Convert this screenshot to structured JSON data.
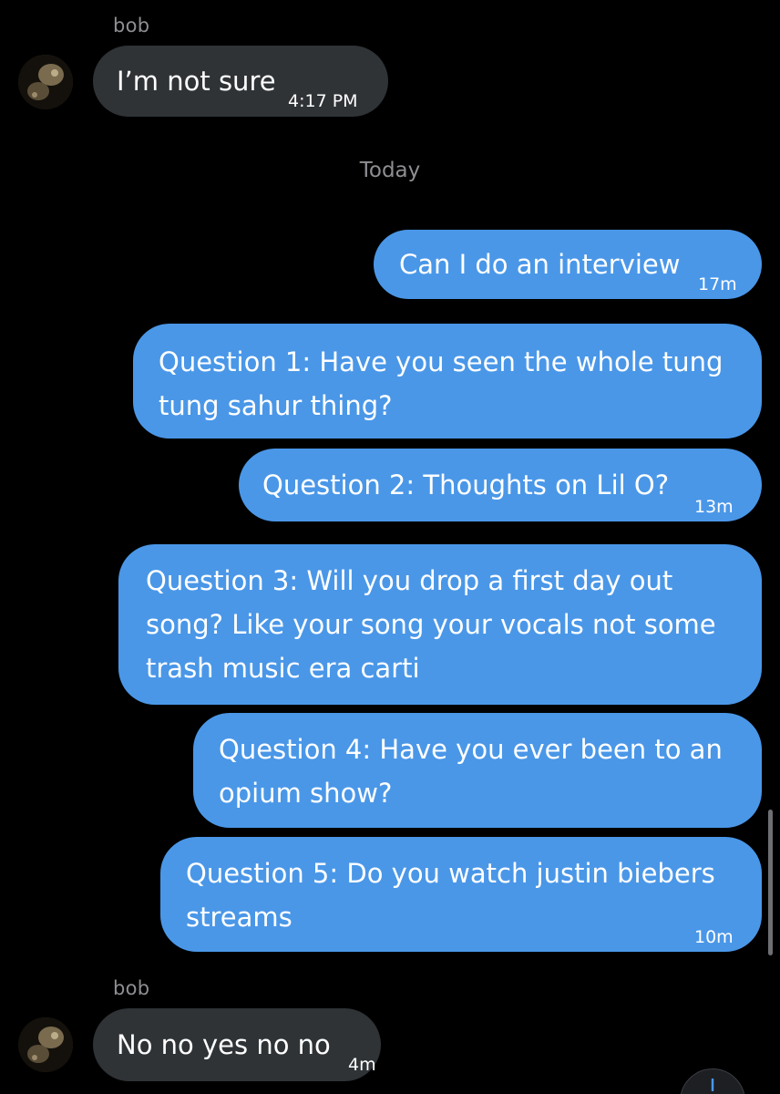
{
  "messages": [
    {
      "sender": "bob",
      "direction": "incoming",
      "text": "I’m not sure",
      "time": "4:17 PM"
    },
    {
      "direction": "outgoing",
      "text": "Can I do an interview",
      "time": "17m"
    },
    {
      "direction": "outgoing",
      "lines": [
        "Question 1: Have you seen the whole tung",
        "tung sahur thing?"
      ]
    },
    {
      "direction": "outgoing",
      "text": "Question 2: Thoughts on Lil O?",
      "time": "13m"
    },
    {
      "direction": "outgoing",
      "lines": [
        "Question 3: Will you drop a first day out",
        "song? Like your song your vocals not some",
        "trash music era carti"
      ]
    },
    {
      "direction": "outgoing",
      "lines": [
        "Question 4: Have you ever been to an",
        "opium show?"
      ]
    },
    {
      "direction": "outgoing",
      "lines": [
        "Question 5: Do you watch justin biebers",
        "streams"
      ],
      "time": "10m"
    },
    {
      "sender": "bob",
      "direction": "incoming",
      "text": "No no yes no no",
      "time": "4m"
    }
  ],
  "date_separator": "Today",
  "colors": {
    "background": "#000000",
    "incoming_bubble": "#2f3336",
    "outgoing_bubble": "#4a97e8",
    "meta_text": "#8e8e93"
  },
  "icons": {
    "avatar": "avatar-image",
    "scroll_down": "chevron-down-icon"
  }
}
